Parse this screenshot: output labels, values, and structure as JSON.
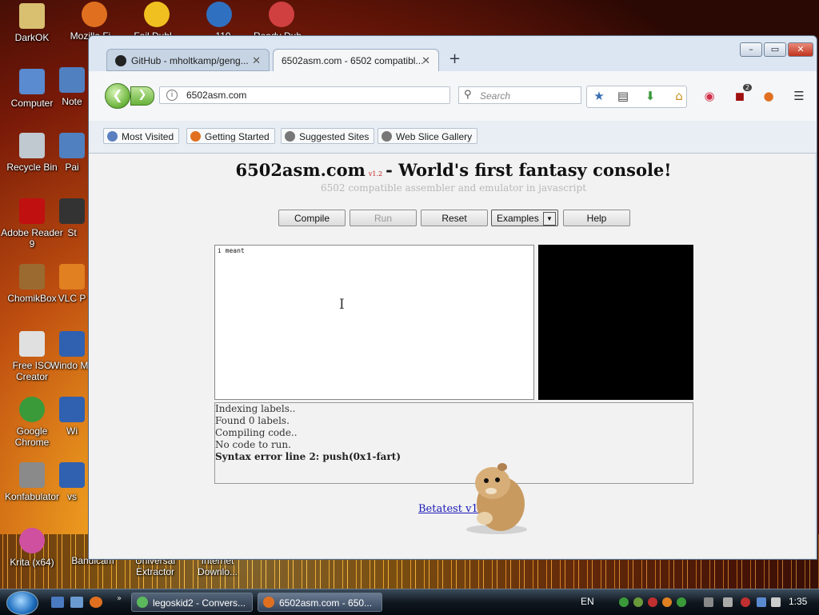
{
  "desktop": {
    "icons": [
      {
        "label": "DarkOK",
        "icon": "folder-icon",
        "color": "#d8c070"
      },
      {
        "label": "Computer",
        "icon": "computer-icon",
        "color": "#5a8ad0"
      },
      {
        "label": "Recycle Bin",
        "icon": "recycle-bin-icon",
        "color": "#c0c8d0"
      },
      {
        "label": "Adobe Reader 9",
        "icon": "pdf-icon",
        "color": "#c01010"
      },
      {
        "label": "ChomikBox",
        "icon": "hamster-icon",
        "color": "#9a6a30"
      },
      {
        "label": "Free ISO Creator",
        "icon": "disc-icon",
        "color": "#e0e0e0"
      },
      {
        "label": "Google Chrome",
        "icon": "chrome-icon",
        "color": "#3a9a3a"
      },
      {
        "label": "Konfabulator",
        "icon": "widget-icon",
        "color": "#8a8a8a"
      },
      {
        "label": "Krita (x64)",
        "icon": "krita-icon",
        "color": "#d050a0"
      },
      {
        "label": "Mozilla Fi...",
        "icon": "firefox-icon",
        "color": "#e07020"
      },
      {
        "label": "Fail Dubl...",
        "icon": "smiley-icon",
        "color": "#f0c020"
      },
      {
        "label": "...110",
        "icon": "ie-icon",
        "color": "#3070c0"
      },
      {
        "label": "Ready Dub...",
        "icon": "app-icon",
        "color": "#d04040"
      },
      {
        "label": "Note",
        "icon": "notepad-icon",
        "color": "#5080c0"
      },
      {
        "label": "Pai",
        "icon": "paint-icon",
        "color": "#5080c0"
      },
      {
        "label": "St",
        "icon": "app-icon",
        "color": "#333333"
      },
      {
        "label": "VLC P",
        "icon": "vlc-icon",
        "color": "#e08020"
      },
      {
        "label": "Windo Me",
        "icon": "media-icon",
        "color": "#3060b0"
      },
      {
        "label": "Wi",
        "icon": "app-icon",
        "color": "#3060b0"
      },
      {
        "label": "vs",
        "icon": "app-icon",
        "color": "#3060b0"
      },
      {
        "label": "Bandicam",
        "icon": "bandicam-icon",
        "color": "#333333"
      },
      {
        "label": "Universal Extractor",
        "icon": "extractor-icon",
        "color": "#555555"
      },
      {
        "label": "Internet Downlo...",
        "icon": "download-icon",
        "color": "#555555"
      }
    ]
  },
  "browser": {
    "tabs": [
      {
        "label": "GitHub - mholtkamp/geng...",
        "close": "✕"
      },
      {
        "label": "6502asm.com - 6502 compatibl...",
        "close": "✕"
      }
    ],
    "new_tab": "+",
    "window_buttons": {
      "minimize": "–",
      "maximize": "▭",
      "close": "✕"
    },
    "url": "6502asm.com",
    "search_placeholder": "Search",
    "ublock_badge": "2",
    "bookmarks": [
      "Most Visited",
      "Getting Started",
      "Suggested Sites",
      "Web Slice Gallery"
    ]
  },
  "page": {
    "title_main": "6502asm.com",
    "title_version": "v1.2",
    "title_rest": "- World's first fantasy console!",
    "subtitle": "6502 compatible assembler and emulator in javascript",
    "buttons": {
      "compile": "Compile",
      "run": "Run",
      "reset": "Reset",
      "examples": "Examples",
      "help": "Help"
    },
    "editor_text": "i meant",
    "log": {
      "lines": [
        "Indexing labels..",
        "Found 0 labels.",
        "Compiling code..",
        "No code to run."
      ],
      "error": "Syntax error line 2: push(0x1-fart)"
    },
    "beta_link": "Betatest v1.5"
  },
  "taskbar": {
    "tasks": [
      "legoskid2 - Convers...",
      "6502asm.com - 650..."
    ],
    "language": "EN",
    "clock": "1:35"
  }
}
